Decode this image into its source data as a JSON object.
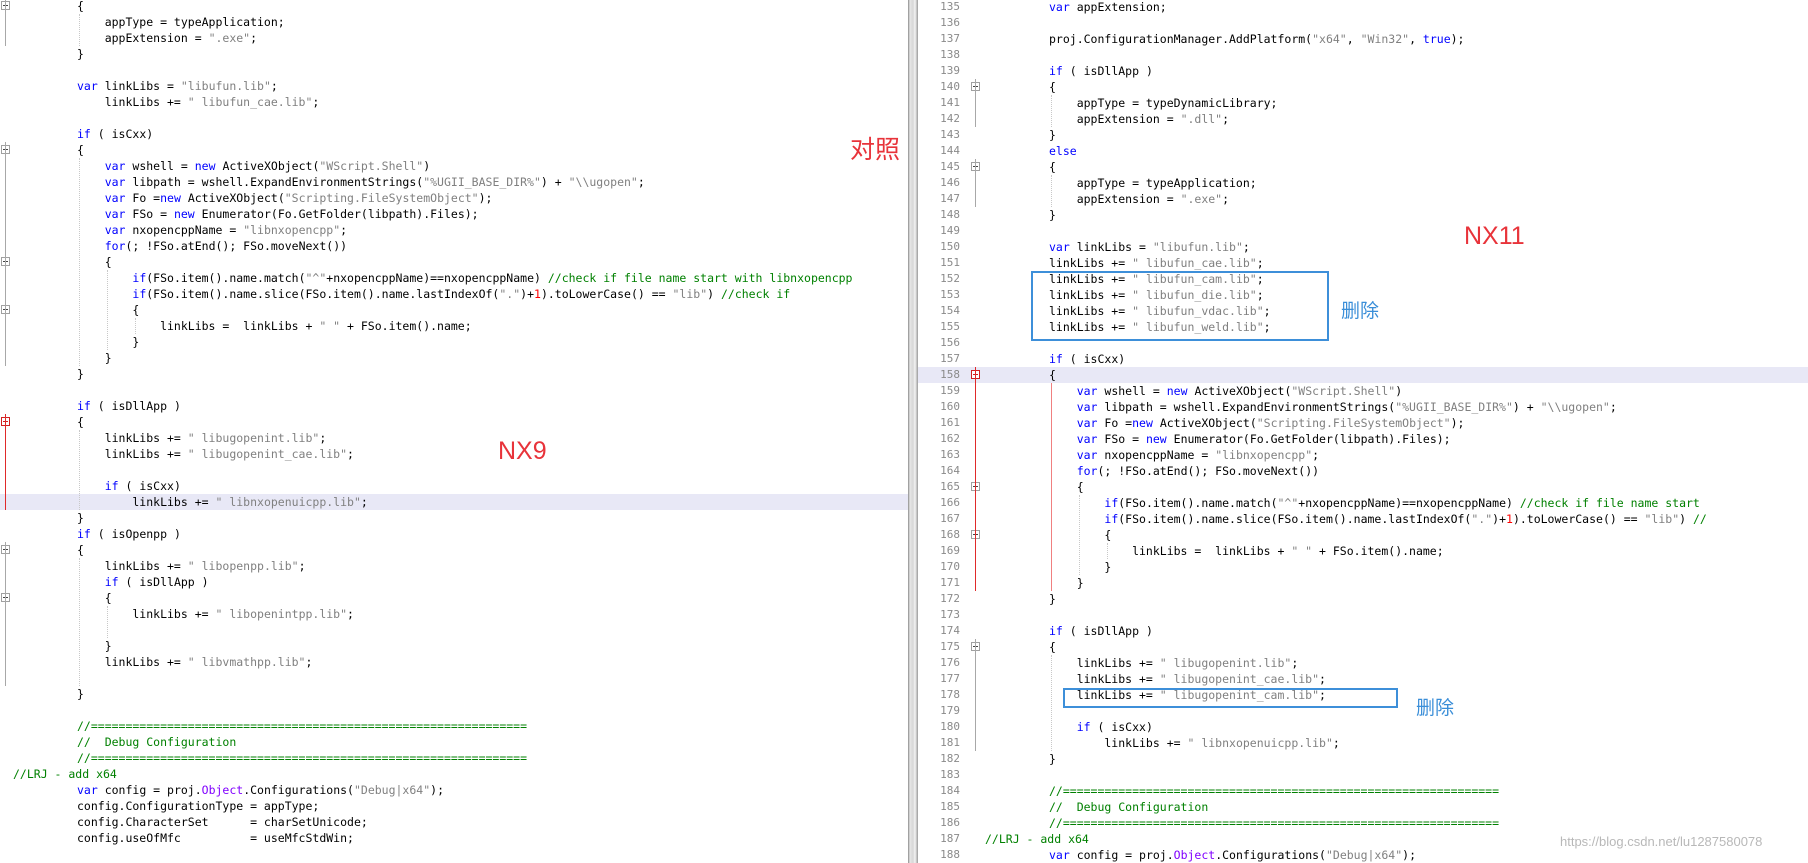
{
  "left_lines": [
    {
      "t": "{",
      "indent": 0
    },
    {
      "t": "    appType = typeApplication;",
      "indent": 0
    },
    {
      "t": "    appExtension = \".exe\";",
      "indent": 0
    },
    {
      "t": "}",
      "indent": 0
    },
    {
      "t": "",
      "indent": 0
    },
    {
      "t": "var linkLibs = \"libufun.lib\";",
      "indent": 0
    },
    {
      "t": "    linkLibs += \" libufun_cae.lib\";",
      "indent": 0
    },
    {
      "t": "",
      "indent": 0
    },
    {
      "t": "if ( isCxx)",
      "indent": 0
    },
    {
      "t": "{",
      "indent": 0
    },
    {
      "t": "    var wshell = new ActiveXObject(\"WScript.Shell\")",
      "indent": 0
    },
    {
      "t": "    var libpath = wshell.ExpandEnvironmentStrings(\"%UGII_BASE_DIR%\") + \"\\\\ugopen\";",
      "indent": 0
    },
    {
      "t": "    var Fo =new ActiveXObject(\"Scripting.FileSystemObject\");",
      "indent": 0
    },
    {
      "t": "    var FSo = new Enumerator(Fo.GetFolder(libpath).Files);",
      "indent": 0
    },
    {
      "t": "    var nxopencppName = \"libnxopencpp\";",
      "indent": 0
    },
    {
      "t": "    for(; !FSo.atEnd(); FSo.moveNext())",
      "indent": 0
    },
    {
      "t": "    {",
      "indent": 0
    },
    {
      "t": "        if(FSo.item().name.match(\"^\"+nxopencppName)==nxopencppName) //check if file name start with libnxopencpp",
      "indent": 0
    },
    {
      "t": "        if(FSo.item().name.slice(FSo.item().name.lastIndexOf(\".\")+1).toLowerCase() == \"lib\") //check if",
      "indent": 0
    },
    {
      "t": "        {",
      "indent": 0
    },
    {
      "t": "            linkLibs =  linkLibs + \" \" + FSo.item().name;",
      "indent": 0
    },
    {
      "t": "        }",
      "indent": 0
    },
    {
      "t": "    }",
      "indent": 0
    },
    {
      "t": "}",
      "indent": 0
    },
    {
      "t": "",
      "indent": 0
    },
    {
      "t": "if ( isDllApp )",
      "indent": 0
    },
    {
      "t": "{",
      "indent": 0
    },
    {
      "t": "    linkLibs += \" libugopenint.lib\";",
      "indent": 0
    },
    {
      "t": "    linkLibs += \" libugopenint_cae.lib\";",
      "indent": 0
    },
    {
      "t": "",
      "indent": 0
    },
    {
      "t": "    if ( isCxx)",
      "indent": 0
    },
    {
      "t": "        linkLibs += \" libnxopenuicpp.lib\";",
      "indent": 0
    },
    {
      "t": "}",
      "indent": 0
    },
    {
      "t": "if ( isOpenpp )",
      "indent": 0
    },
    {
      "t": "{",
      "indent": 0
    },
    {
      "t": "    linkLibs += \" libopenpp.lib\";",
      "indent": 0
    },
    {
      "t": "    if ( isDllApp )",
      "indent": 0
    },
    {
      "t": "    {",
      "indent": 0
    },
    {
      "t": "        linkLibs += \" libopenintpp.lib\";",
      "indent": 0
    },
    {
      "t": "",
      "indent": 0
    },
    {
      "t": "    }",
      "indent": 0
    },
    {
      "t": "    linkLibs += \" libvmathpp.lib\";",
      "indent": 0
    },
    {
      "t": "",
      "indent": 0
    },
    {
      "t": "}",
      "indent": 0
    },
    {
      "t": "",
      "indent": 0
    },
    {
      "t": "//===============================================================",
      "indent": 0
    },
    {
      "t": "//  Debug Configuration",
      "indent": 0
    },
    {
      "t": "//===============================================================",
      "indent": 0
    },
    {
      "t": "//LRJ - add x64",
      "indent": -1
    },
    {
      "t": "var config = proj.Object.Configurations(\"Debug|x64\");",
      "indent": 0
    },
    {
      "t": "config.ConfigurationType = appType;",
      "indent": 0
    },
    {
      "t": "config.CharacterSet      = charSetUnicode;",
      "indent": 0
    },
    {
      "t": "config.useOfMfc          = useMfcStdWin;",
      "indent": 0
    }
  ],
  "right_lines": [
    {
      "n": "135",
      "t": "var appExtension;",
      "indent": 0
    },
    {
      "n": "136",
      "t": "",
      "indent": 0
    },
    {
      "n": "137",
      "t": "proj.ConfigurationManager.AddPlatform(\"x64\", \"Win32\", true);",
      "indent": 0
    },
    {
      "n": "138",
      "t": "",
      "indent": 0
    },
    {
      "n": "139",
      "t": "if ( isDllApp )",
      "indent": 0
    },
    {
      "n": "140",
      "t": "{",
      "indent": 0
    },
    {
      "n": "141",
      "t": "    appType = typeDynamicLibrary;",
      "indent": 0
    },
    {
      "n": "142",
      "t": "    appExtension = \".dll\";",
      "indent": 0
    },
    {
      "n": "143",
      "t": "}",
      "indent": 0
    },
    {
      "n": "144",
      "t": "else",
      "indent": 0
    },
    {
      "n": "145",
      "t": "{",
      "indent": 0
    },
    {
      "n": "146",
      "t": "    appType = typeApplication;",
      "indent": 0
    },
    {
      "n": "147",
      "t": "    appExtension = \".exe\";",
      "indent": 0
    },
    {
      "n": "148",
      "t": "}",
      "indent": 0
    },
    {
      "n": "149",
      "t": "",
      "indent": 0
    },
    {
      "n": "150",
      "t": "var linkLibs = \"libufun.lib\";",
      "indent": 0
    },
    {
      "n": "151",
      "t": "linkLibs += \" libufun_cae.lib\";",
      "indent": 0
    },
    {
      "n": "152",
      "t": "linkLibs += \" libufun_cam.lib\";",
      "indent": 0
    },
    {
      "n": "153",
      "t": "linkLibs += \" libufun_die.lib\";",
      "indent": 0
    },
    {
      "n": "154",
      "t": "linkLibs += \" libufun_vdac.lib\";",
      "indent": 0
    },
    {
      "n": "155",
      "t": "linkLibs += \" libufun_weld.lib\";",
      "indent": 0
    },
    {
      "n": "156",
      "t": "",
      "indent": 0
    },
    {
      "n": "157",
      "t": "if ( isCxx)",
      "indent": 0
    },
    {
      "n": "158",
      "t": "{",
      "indent": 0
    },
    {
      "n": "159",
      "t": "    var wshell = new ActiveXObject(\"WScript.Shell\")",
      "indent": 0
    },
    {
      "n": "160",
      "t": "    var libpath = wshell.ExpandEnvironmentStrings(\"%UGII_BASE_DIR%\") + \"\\\\ugopen\";",
      "indent": 0
    },
    {
      "n": "161",
      "t": "    var Fo =new ActiveXObject(\"Scripting.FileSystemObject\");",
      "indent": 0
    },
    {
      "n": "162",
      "t": "    var FSo = new Enumerator(Fo.GetFolder(libpath).Files);",
      "indent": 0
    },
    {
      "n": "163",
      "t": "    var nxopencppName = \"libnxopencpp\";",
      "indent": 0
    },
    {
      "n": "164",
      "t": "    for(; !FSo.atEnd(); FSo.moveNext())",
      "indent": 0
    },
    {
      "n": "165",
      "t": "    {",
      "indent": 0
    },
    {
      "n": "166",
      "t": "        if(FSo.item().name.match(\"^\"+nxopencppName)==nxopencppName) //check if file name start",
      "indent": 0
    },
    {
      "n": "167",
      "t": "        if(FSo.item().name.slice(FSo.item().name.lastIndexOf(\".\")+1).toLowerCase() == \"lib\") //",
      "indent": 0
    },
    {
      "n": "168",
      "t": "        {",
      "indent": 0
    },
    {
      "n": "169",
      "t": "            linkLibs =  linkLibs + \" \" + FSo.item().name;",
      "indent": 0
    },
    {
      "n": "170",
      "t": "        }",
      "indent": 0
    },
    {
      "n": "171",
      "t": "    }",
      "indent": 0
    },
    {
      "n": "172",
      "t": "}",
      "indent": 0
    },
    {
      "n": "173",
      "t": "",
      "indent": 0
    },
    {
      "n": "174",
      "t": "if ( isDllApp )",
      "indent": 0
    },
    {
      "n": "175",
      "t": "{",
      "indent": 0
    },
    {
      "n": "176",
      "t": "    linkLibs += \" libugopenint.lib\";",
      "indent": 0
    },
    {
      "n": "177",
      "t": "    linkLibs += \" libugopenint_cae.lib\";",
      "indent": 0
    },
    {
      "n": "178",
      "t": "    linkLibs += \" libugopenint_cam.lib\";",
      "indent": 0
    },
    {
      "n": "179",
      "t": "",
      "indent": 0
    },
    {
      "n": "180",
      "t": "    if ( isCxx)",
      "indent": 0
    },
    {
      "n": "181",
      "t": "        linkLibs += \" libnxopenuicpp.lib\";",
      "indent": 0
    },
    {
      "n": "182",
      "t": "}",
      "indent": 0
    },
    {
      "n": "183",
      "t": "",
      "indent": 0
    },
    {
      "n": "184",
      "t": "//===============================================================",
      "indent": 0
    },
    {
      "n": "185",
      "t": "//  Debug Configuration",
      "indent": 0
    },
    {
      "n": "186",
      "t": "//===============================================================",
      "indent": 0
    },
    {
      "n": "187",
      "t": "//LRJ - add x64",
      "indent": -1
    },
    {
      "n": "188",
      "t": "var config = proj.Object.Configurations(\"Debug|x64\");",
      "indent": 0
    }
  ],
  "annotations": {
    "compare": "对照",
    "nx9": "NX9",
    "nx11": "NX11",
    "delete_1": "删除",
    "delete_2": "删除"
  },
  "watermark": "https://blog.csdn.net/lu1287580078",
  "colors": {
    "keyword": "#0000ff",
    "string": "#808080",
    "comment": "#008000",
    "number": "#ff0000",
    "highlight": "#e8e8f6",
    "annotation_red": "#e8333a",
    "annotation_blue": "#3a8ed8"
  }
}
